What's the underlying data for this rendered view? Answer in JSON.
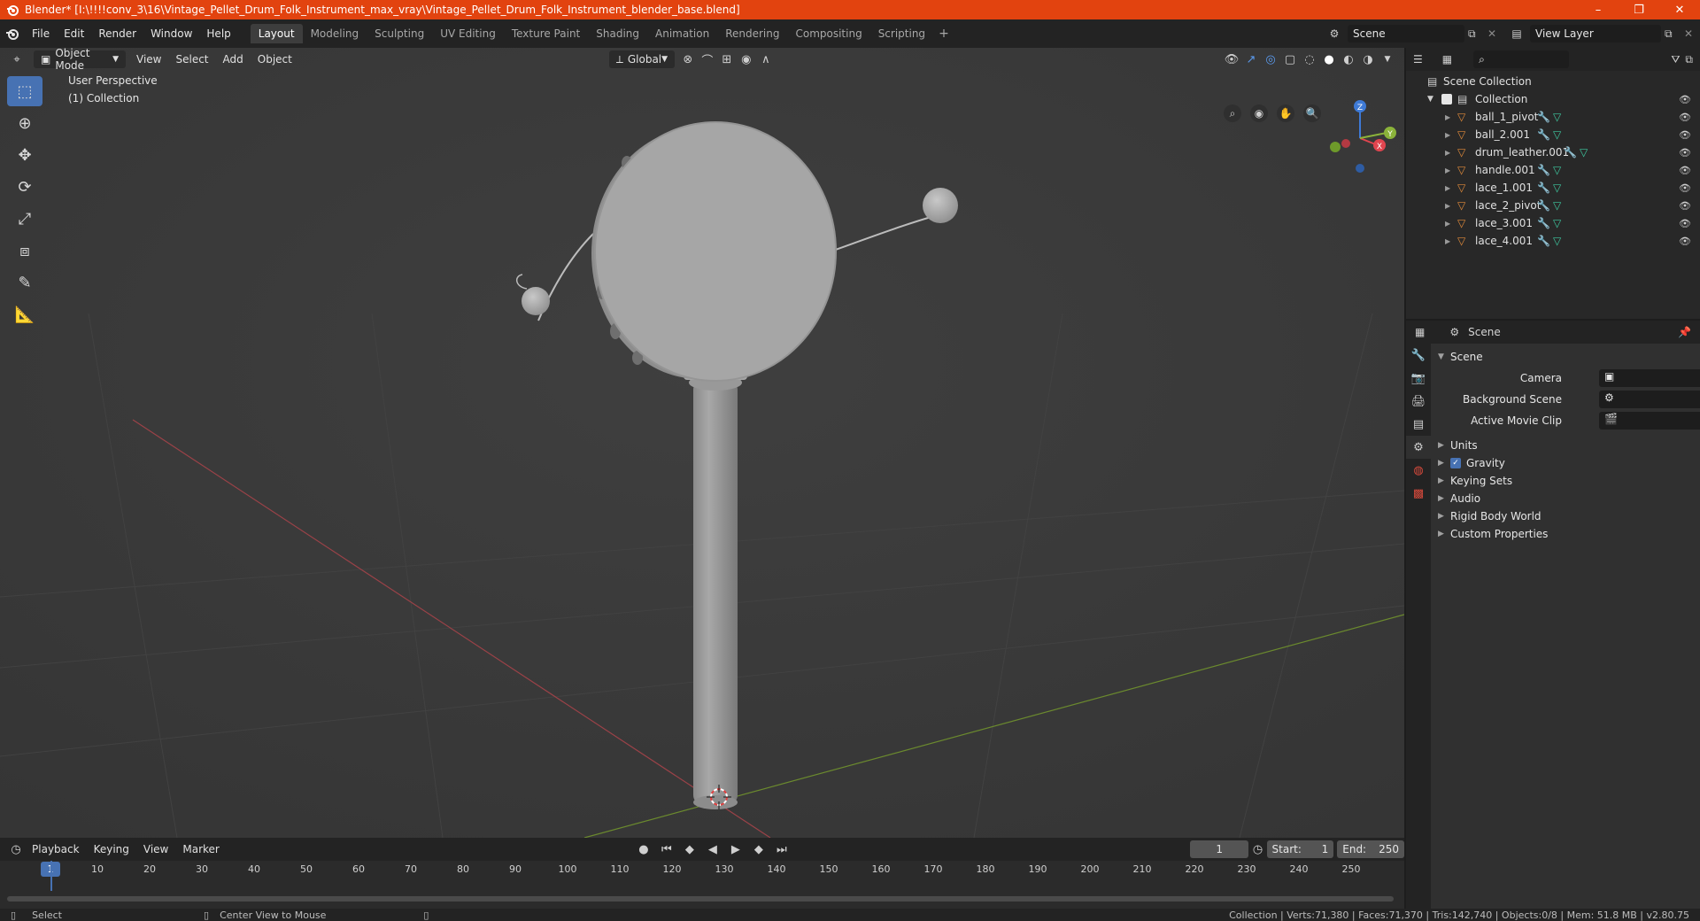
{
  "titlebar": {
    "title": "Blender* [I:\\!!!!conv_3\\16\\Vintage_Pellet_Drum_Folk_Instrument_max_vray\\Vintage_Pellet_Drum_Folk_Instrument_blender_base.blend]",
    "minimize": "–",
    "maximize": "❐",
    "close": "✕"
  },
  "menu": {
    "file": "File",
    "edit": "Edit",
    "render": "Render",
    "window": "Window",
    "help": "Help"
  },
  "workspaces": [
    "Layout",
    "Modeling",
    "Sculpting",
    "UV Editing",
    "Texture Paint",
    "Shading",
    "Animation",
    "Rendering",
    "Compositing",
    "Scripting"
  ],
  "scene_field": "Scene",
  "view_layer_field": "View Layer",
  "viewport": {
    "mode": "Object Mode",
    "menus": [
      "View",
      "Select",
      "Add",
      "Object"
    ],
    "transform_orientation": "Global",
    "perspective_label": "User Perspective",
    "collection_label": "(1) Collection"
  },
  "timeline": {
    "menus": [
      "Playback",
      "Keying",
      "View",
      "Marker"
    ],
    "current_frame": "1",
    "start_label": "Start:",
    "start_value": "1",
    "end_label": "End:",
    "end_value": "250",
    "ticks": [
      "10",
      "20",
      "30",
      "40",
      "50",
      "60",
      "70",
      "80",
      "90",
      "100",
      "110",
      "120",
      "130",
      "140",
      "150",
      "160",
      "170",
      "180",
      "190",
      "200",
      "210",
      "220",
      "230",
      "240",
      "250"
    ],
    "playhead": "1"
  },
  "status": {
    "left_action": "Select",
    "middle_action": "Center View to Mouse",
    "stats": "Collection | Verts:71,380 | Faces:71,370 | Tris:142,740 | Objects:0/8 | Mem: 51.8 MB | v2.80.75"
  },
  "outliner": {
    "scene_collection": "Scene Collection",
    "collection": "Collection",
    "items": [
      "ball_1_pivot",
      "ball_2.001",
      "drum_leather.001",
      "handle.001",
      "lace_1.001",
      "lace_2_pivot",
      "lace_3.001",
      "lace_4.001"
    ]
  },
  "properties": {
    "header": "Scene",
    "panel_title": "Scene",
    "camera_label": "Camera",
    "background_scene_label": "Background Scene",
    "active_movie_clip_label": "Active Movie Clip",
    "sections": [
      "Units",
      "Gravity",
      "Keying Sets",
      "Audio",
      "Rigid Body World",
      "Custom Properties"
    ]
  },
  "colors": {
    "titlebar": "#e2430f",
    "accent": "#4772b3",
    "x_axis": "#e0454f",
    "y_axis": "#8bb33a",
    "z_axis": "#3e7ad6"
  }
}
